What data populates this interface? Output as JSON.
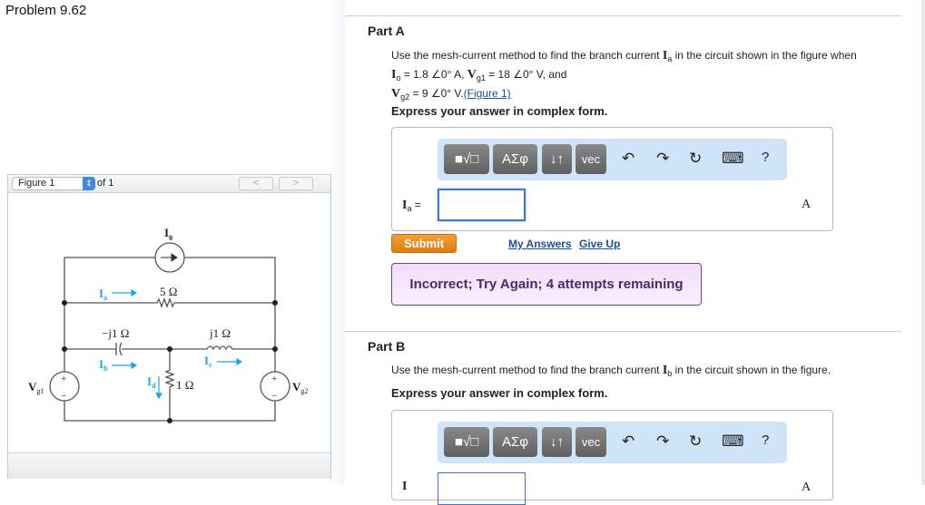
{
  "problem_title": "Problem 9.62",
  "figure": {
    "selected": "Figure 1",
    "of_label": "of 1",
    "prev": "<",
    "next": ">",
    "labels": {
      "I0": "I",
      "I0_sub": "0",
      "Ia": "I",
      "Ia_sub": "a",
      "Ib": "I",
      "Ib_sub": "b",
      "Ic": "I",
      "Ic_sub": "c",
      "Id": "I",
      "Id_sub": "d",
      "R5": "5 Ω",
      "C": "−j1 Ω",
      "L": "j1 Ω",
      "R1": "1 Ω",
      "Vg1": "V",
      "Vg1_sub": "g1",
      "Vg2": "V",
      "Vg2_sub": "g2",
      "plus": "+",
      "minus": "−"
    },
    "accent": "#1aa6e0"
  },
  "partA": {
    "title": "Part A",
    "q1": "Use the mesh-current method to find the branch current ",
    "q1_var": "I",
    "q1_sub": "a",
    "q1_end": " in the circuit shown in the figure when",
    "l2a": "I",
    "l2a_sub": "o",
    "l2b": " = 1.8 ∠0° A, ",
    "l2c": "V",
    "l2c_sub": "g1",
    "l2d": " = 18 ∠0° V",
    "l2e": ", and",
    "l3a": "V",
    "l3a_sub": "g2",
    "l3b": " = 9 ∠0° V.",
    "l3_link": "(Figure 1)",
    "express": "Express your answer in complex form.",
    "label_var": "I",
    "label_sub": "a",
    "label_eq": " =",
    "unit": "A",
    "value": "",
    "submit": "Submit",
    "my_answers": "My Answers",
    "give_up": "Give Up",
    "feedback": "Incorrect; Try Again; 4 attempts remaining"
  },
  "toolbar": {
    "templates": "■√□",
    "greek": "ΑΣφ",
    "arrows": "↓↑",
    "vec": "vec",
    "undo": "↶",
    "redo": "↷",
    "reset": "↻",
    "keyboard": "⌨",
    "help": "?"
  },
  "partB": {
    "title": "Part B",
    "q1": "Use the mesh-current method to find the branch current ",
    "q1_var": "I",
    "q1_sub": "b",
    "q1_end": " in the circuit shown in the figure.",
    "express": "Express your answer in complex form.",
    "label_var": "I",
    "unit": "A"
  }
}
